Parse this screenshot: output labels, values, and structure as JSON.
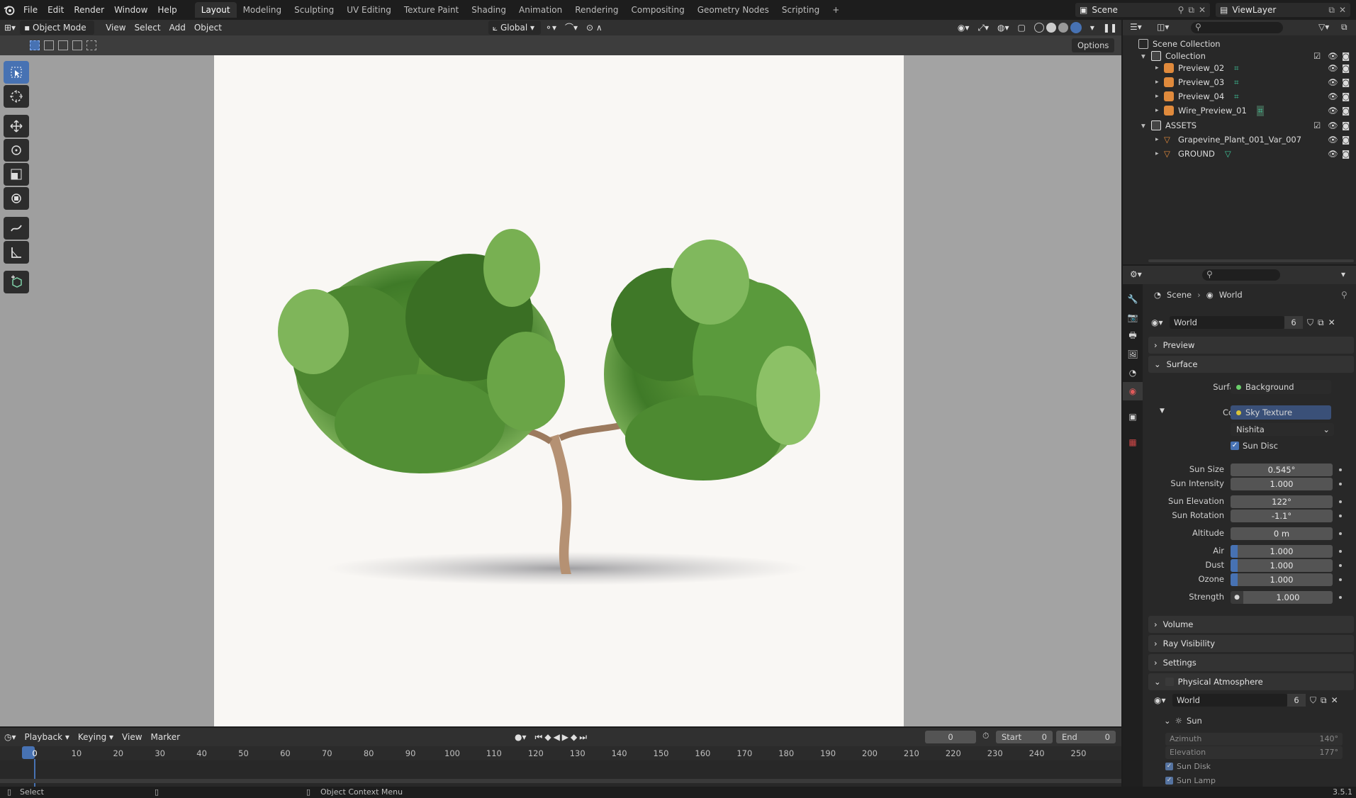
{
  "topbar": {
    "menus": [
      "File",
      "Edit",
      "Render",
      "Window",
      "Help"
    ],
    "workspaces": [
      "Layout",
      "Modeling",
      "Sculpting",
      "UV Editing",
      "Texture Paint",
      "Shading",
      "Animation",
      "Rendering",
      "Compositing",
      "Geometry Nodes",
      "Scripting"
    ],
    "active_workspace": "Layout",
    "add_tab": "+",
    "scene": "Scene",
    "view_layer": "ViewLayer"
  },
  "viewport_header": {
    "mode": "Object Mode",
    "menus": [
      "View",
      "Select",
      "Add",
      "Object"
    ],
    "orientation": "Global",
    "options": "Options"
  },
  "outliner": {
    "root": "Scene Collection",
    "rows": [
      {
        "label": "Collection",
        "type": "collection"
      },
      {
        "label": "Preview_02",
        "type": "camera"
      },
      {
        "label": "Preview_03",
        "type": "camera"
      },
      {
        "label": "Preview_04",
        "type": "camera"
      },
      {
        "label": "Wire_Preview_01",
        "type": "camera"
      },
      {
        "label": "ASSETS",
        "type": "collection"
      },
      {
        "label": "Grapevine_Plant_001_Var_007",
        "type": "mesh"
      },
      {
        "label": "GROUND",
        "type": "mesh"
      }
    ]
  },
  "properties": {
    "breadcrumb": [
      "Scene",
      "World"
    ],
    "world_name": "World",
    "world_users": "6",
    "panels": {
      "preview": "Preview",
      "surface": "Surface",
      "volume": "Volume",
      "ray_visibility": "Ray Visibility",
      "settings": "Settings",
      "physical_atmosphere": "Physical Atmosphere"
    },
    "surface": {
      "surface_label": "Surface",
      "surface_value": "Background",
      "color_label": "Color",
      "color_value": "Sky Texture",
      "sky_type": "Nishita",
      "sun_disc_label": "Sun Disc",
      "fields": [
        {
          "label": "Sun Size",
          "value": "0.545°"
        },
        {
          "label": "Sun Intensity",
          "value": "1.000"
        },
        {
          "label": "Sun Elevation",
          "value": "122°"
        },
        {
          "label": "Sun Rotation",
          "value": "-1.1°"
        },
        {
          "label": "Altitude",
          "value": "0 m"
        },
        {
          "label": "Air",
          "value": "1.000"
        },
        {
          "label": "Dust",
          "value": "1.000"
        },
        {
          "label": "Ozone",
          "value": "1.000"
        }
      ],
      "strength_label": "Strength",
      "strength_value": "1.000"
    },
    "atmosphere": {
      "world_name": "World",
      "world_users": "6",
      "sun_label": "Sun",
      "azimuth_label": "Azimuth",
      "azimuth_value": "140°",
      "elevation_label": "Elevation",
      "elevation_value": "177°",
      "sun_disk_label": "Sun Disk",
      "sun_lamp_label": "Sun Lamp"
    }
  },
  "timeline": {
    "menus": [
      "Playback",
      "Keying",
      "View",
      "Marker"
    ],
    "current_frame": "0",
    "start_label": "Start",
    "start_value": "0",
    "end_label": "End",
    "end_value": "0",
    "ticks": [
      "0",
      "10",
      "20",
      "30",
      "40",
      "50",
      "60",
      "70",
      "80",
      "90",
      "100",
      "110",
      "120",
      "130",
      "140",
      "150",
      "160",
      "170",
      "180",
      "190",
      "200",
      "210",
      "220",
      "230",
      "240",
      "250"
    ]
  },
  "statusbar": {
    "left": "Select",
    "middle": "Object Context Menu",
    "version": "3.5.1"
  },
  "colors": {
    "accent": "#4772b3",
    "camera_icon": "#e08a3c",
    "mesh_icon": "#e08a3c",
    "data_icon": "#3fc59a"
  }
}
